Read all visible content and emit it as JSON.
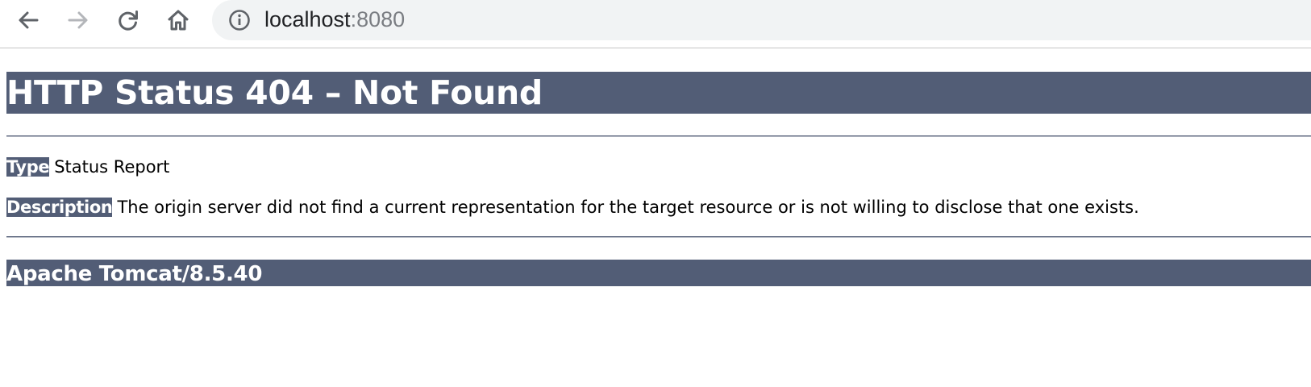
{
  "browser": {
    "address_bar": {
      "host": "localhost",
      "port": ":8080"
    },
    "icons": {
      "back": "arrow-left-icon",
      "forward": "arrow-right-icon",
      "reload": "reload-icon",
      "home": "home-icon",
      "site_info": "info-circle-icon"
    },
    "forward_enabled": false
  },
  "error_page": {
    "title": "HTTP Status 404 – Not Found",
    "type_label": "Type",
    "type_value": "Status Report",
    "description_label": "Description",
    "description_value": "The origin server did not find a current representation for the target resource or is not willing to disclose that one exists.",
    "server": "Apache Tomcat/8.5.40"
  },
  "colors": {
    "header_bg": "#525d76",
    "header_text": "#ffffff",
    "omnibox_bg": "#f1f3f4",
    "port_text": "#7a7d82"
  }
}
